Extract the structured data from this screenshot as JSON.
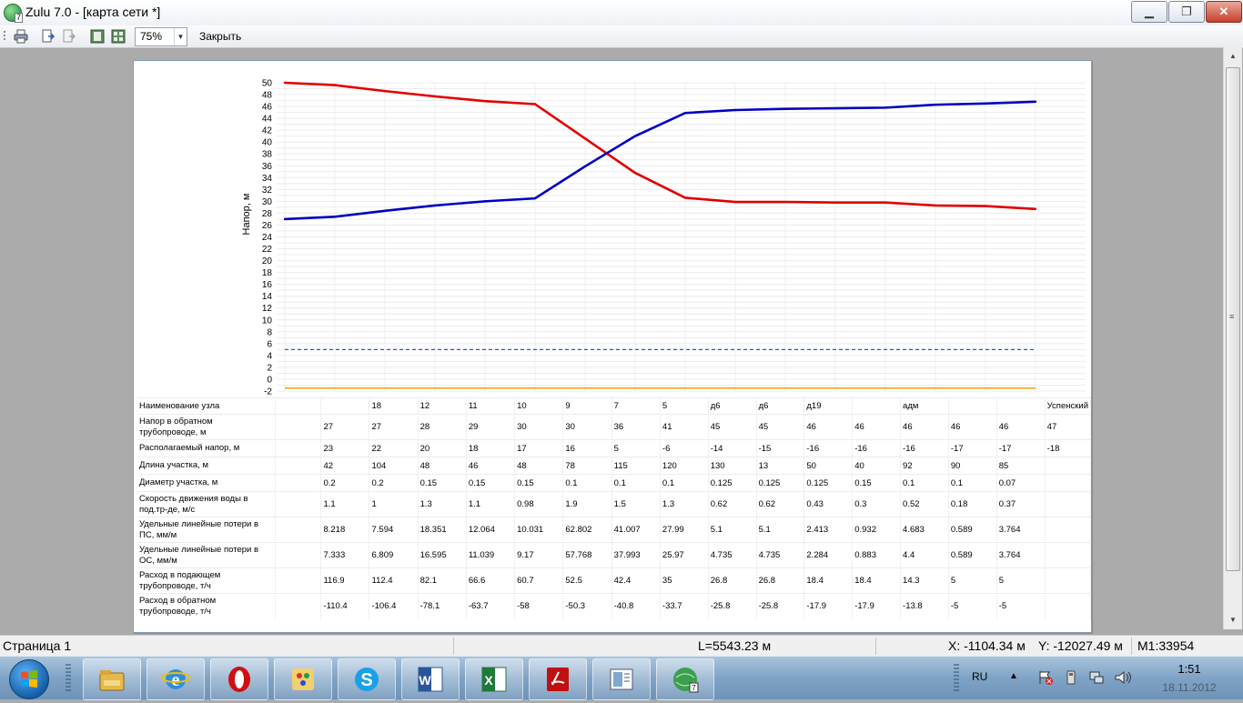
{
  "window": {
    "title": "Zulu 7.0 - [карта сети *]",
    "minimize_glyph": "▁",
    "maximize_glyph": "❐",
    "close_glyph": "✕"
  },
  "toolbar": {
    "zoom_value": "75%",
    "zoom_arrow": "▼",
    "close_label": "Закрыть",
    "icons": [
      "print-icon",
      "page-forward-icon",
      "page-back-icon",
      "single-page-icon",
      "multi-page-icon"
    ]
  },
  "chart_data": {
    "type": "line",
    "title": "",
    "xlabel": "",
    "ylabel": "Напор, м",
    "ylim": [
      -2,
      50
    ],
    "yticks": [
      50,
      48,
      46,
      44,
      42,
      40,
      38,
      36,
      34,
      32,
      30,
      28,
      26,
      24,
      22,
      20,
      18,
      16,
      14,
      12,
      10,
      8,
      6,
      4,
      2,
      0,
      -2
    ],
    "x": [
      0,
      1,
      2,
      3,
      4,
      5,
      6,
      7,
      8,
      9,
      10,
      11,
      12,
      13,
      14,
      15
    ],
    "series": [
      {
        "color": "#e00000",
        "style": "solid",
        "values": [
          50.0,
          49.6,
          48.6,
          47.7,
          46.9,
          46.4,
          40.6,
          34.8,
          30.6,
          29.9,
          29.9,
          29.8,
          29.8,
          29.3,
          29.2,
          28.7
        ]
      },
      {
        "color": "#0000c0",
        "style": "solid",
        "values": [
          27.0,
          27.4,
          28.4,
          29.3,
          30.0,
          30.5,
          35.9,
          41.0,
          44.9,
          45.4,
          45.6,
          45.7,
          45.8,
          46.3,
          46.5,
          46.8
        ]
      },
      {
        "color": "#1f5fbf",
        "style": "dashed",
        "values": [
          5,
          5,
          5,
          5,
          5,
          5,
          5,
          5,
          5,
          5,
          5,
          5,
          5,
          5,
          5,
          5
        ]
      },
      {
        "color": "#f0a000",
        "style": "solid",
        "values": [
          -1.5,
          -1.5,
          -1.5,
          -1.5,
          -1.5,
          -1.5,
          -1.5,
          -1.5,
          -1.5,
          -1.5,
          -1.5,
          -1.5,
          -1.5,
          -1.5,
          -1.5,
          -1.5
        ]
      }
    ],
    "grid": true
  },
  "table": {
    "rows": [
      {
        "label": "Наименование узла",
        "values": [
          "",
          "18",
          "12",
          "11",
          "10",
          "9",
          "7",
          "5",
          "д6",
          "д6",
          "д19",
          "",
          "адм",
          "",
          "",
          "Успенский"
        ]
      },
      {
        "label": "Напор в обратном трубопроводе, м",
        "values": [
          "27",
          "27",
          "28",
          "29",
          "30",
          "30",
          "36",
          "41",
          "45",
          "45",
          "46",
          "46",
          "46",
          "46",
          "46",
          "47"
        ]
      },
      {
        "label": "Располагаемый напор, м",
        "values": [
          "23",
          "22",
          "20",
          "18",
          "17",
          "16",
          "5",
          "-6",
          "-14",
          "-15",
          "-16",
          "-16",
          "-16",
          "-17",
          "-17",
          "-18"
        ]
      },
      {
        "label": "Длина участка, м",
        "values": [
          "42",
          "104",
          "48",
          "46",
          "48",
          "78",
          "115",
          "120",
          "130",
          "13",
          "50",
          "40",
          "92",
          "90",
          "85",
          ""
        ]
      },
      {
        "label": "Диаметр участка, м",
        "values": [
          "0.2",
          "0.2",
          "0.15",
          "0.15",
          "0.15",
          "0.1",
          "0.1",
          "0.1",
          "0.125",
          "0.125",
          "0.125",
          "0.15",
          "0.1",
          "0.1",
          "0.07",
          ""
        ]
      },
      {
        "label": "Скорость движения воды в под.тр-де, м/с",
        "values": [
          "1.1",
          "1",
          "1.3",
          "1.1",
          "0.98",
          "1.9",
          "1.5",
          "1.3",
          "0.62",
          "0.62",
          "0.43",
          "0.3",
          "0.52",
          "0.18",
          "0.37",
          ""
        ]
      },
      {
        "label": "Удельные линейные потери в ПС, мм/м",
        "values": [
          "8.218",
          "7.594",
          "18.351",
          "12.064",
          "10.031",
          "62.802",
          "41.007",
          "27.99",
          "5.1",
          "5.1",
          "2.413",
          "0.932",
          "4.683",
          "0.589",
          "3.764",
          ""
        ]
      },
      {
        "label": "Удельные линейные потери в ОС, мм/м",
        "values": [
          "7.333",
          "6.809",
          "16.595",
          "11.039",
          "9.17",
          "57.768",
          "37.993",
          "25.97",
          "4.735",
          "4.735",
          "2.284",
          "0.883",
          "4.4",
          "0.589",
          "3.764",
          ""
        ]
      },
      {
        "label": "Расход в подающем трубопроводе, т/ч",
        "values": [
          "116.9",
          "112.4",
          "82.1",
          "66.6",
          "60.7",
          "52.5",
          "42.4",
          "35",
          "26.8",
          "26.8",
          "18.4",
          "18.4",
          "14.3",
          "5",
          "5",
          ""
        ]
      },
      {
        "label": "Расход в обратном трубопроводе, т/ч",
        "values": [
          "-110.4",
          "-106.4",
          "-78.1",
          "-63.7",
          "-58",
          "-50.3",
          "-40.8",
          "-33.7",
          "-25.8",
          "-25.8",
          "-17.9",
          "-17.9",
          "-13.8",
          "-5",
          "-5",
          ""
        ]
      }
    ]
  },
  "statusbar": {
    "page": "Страница 1",
    "length": "L=5543.23 м",
    "x_coord": "X:  -1104.34 м",
    "y_coord": "Y: -12027.49 м",
    "scale": "M1:33954"
  },
  "taskbar": {
    "apps": [
      "explorer-icon",
      "internet-explorer-icon",
      "opera-icon",
      "paint-icon",
      "skype-icon",
      "word-icon",
      "excel-icon",
      "pdf-reader-icon",
      "document-viewer-icon",
      "zulu-icon"
    ],
    "lang": "RU",
    "time": "1:51",
    "date": "18.11.2012",
    "tray_arrow": "▲"
  }
}
